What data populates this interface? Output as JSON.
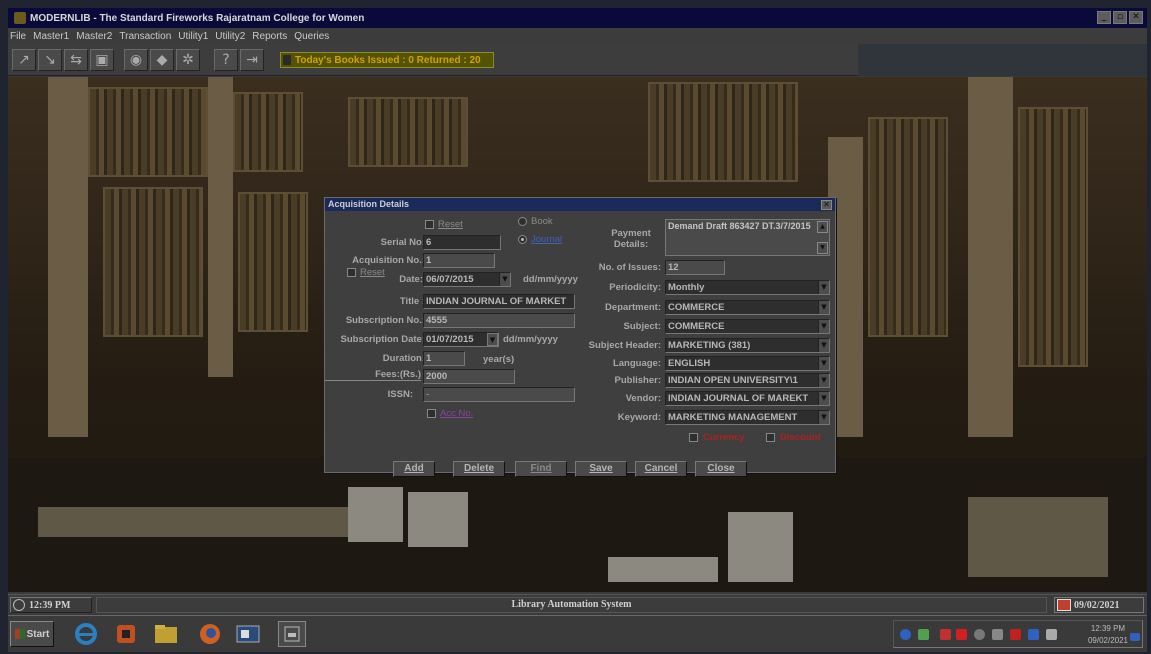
{
  "app": {
    "title": "MODERNLIB - The Standard Fireworks Rajaratnam College for Women"
  },
  "menu": [
    "File",
    "Master1",
    "Master2",
    "Transaction",
    "Utility1",
    "Utility2",
    "Reports",
    "Queries"
  ],
  "toolbar": {
    "today_label": "Today's Books Issued : 0 Returned : 20"
  },
  "dialog": {
    "title": "Acquisition Details",
    "reset_top_label": "Reset",
    "book_label": "Book",
    "journal_label": "Journal",
    "serial_label": "Serial No:",
    "serial_value": "6",
    "acq_label": "Acquisition No.:",
    "acq_value": "1",
    "reset_label": "Reset",
    "date_label": "Date:",
    "date_value": "06/07/2015",
    "date_hint": "dd/mm/yyyy",
    "title_label": "Title :",
    "title_value": "INDIAN JOURNAL OF MARKET",
    "subno_label": "Subscription No.:",
    "subno_value": "4555",
    "subdate_label": "Subscription Date:",
    "subdate_value": "01/07/2015",
    "subdate_hint": "dd/mm/yyyy",
    "duration_label": "Duration:",
    "duration_value": "1",
    "duration_unit": "year(s)",
    "fees_label": "Fees:(Rs.)",
    "fees_value": "2000",
    "issn_label": "ISSN:",
    "issn_value": "-",
    "accno_label": "Acc No.",
    "payment_label": "Payment Details:",
    "payment_value": "Demand Draft 863427 DT.3/7/2015",
    "issues_label": "No. of Issues:",
    "issues_value": "12",
    "periodicity_label": "Periodicity:",
    "periodicity_value": "Monthly",
    "department_label": "Department:",
    "department_value": "COMMERCE",
    "subject_label": "Subject:",
    "subject_value": "COMMERCE",
    "subject_header_label": "Subject Header:",
    "subject_header_value": "MARKETING (381)",
    "language_label": "Language:",
    "language_value": "ENGLISH",
    "publisher_label": "Publisher:",
    "publisher_value": "INDIAN OPEN UNIVERSITY\\1",
    "vendor_label": "Vendor:",
    "vendor_value": "INDIAN JOURNAL OF MAREKT",
    "keyword_label": "Keyword:",
    "keyword_value": "MARKETING MANAGEMENT",
    "currency_label": "Currency",
    "discount_label": "Discount",
    "buttons": {
      "add": "Add",
      "delete": "Delete",
      "find": "Find",
      "save": "Save",
      "cancel": "Cancel",
      "close": "Close"
    }
  },
  "status": {
    "time": "12:39 PM",
    "center": "Library Automation System",
    "date": "09/02/2021"
  },
  "taskbar": {
    "start": "Start",
    "tray_time": "12:39 PM",
    "tray_date": "09/02/2021"
  },
  "colors": {
    "title_bar": "#0a0a3a",
    "today_text": "#d2a000",
    "label_red": "#b02020",
    "radio_blue": "#4060c0",
    "acc_purple": "#8a40a0"
  }
}
